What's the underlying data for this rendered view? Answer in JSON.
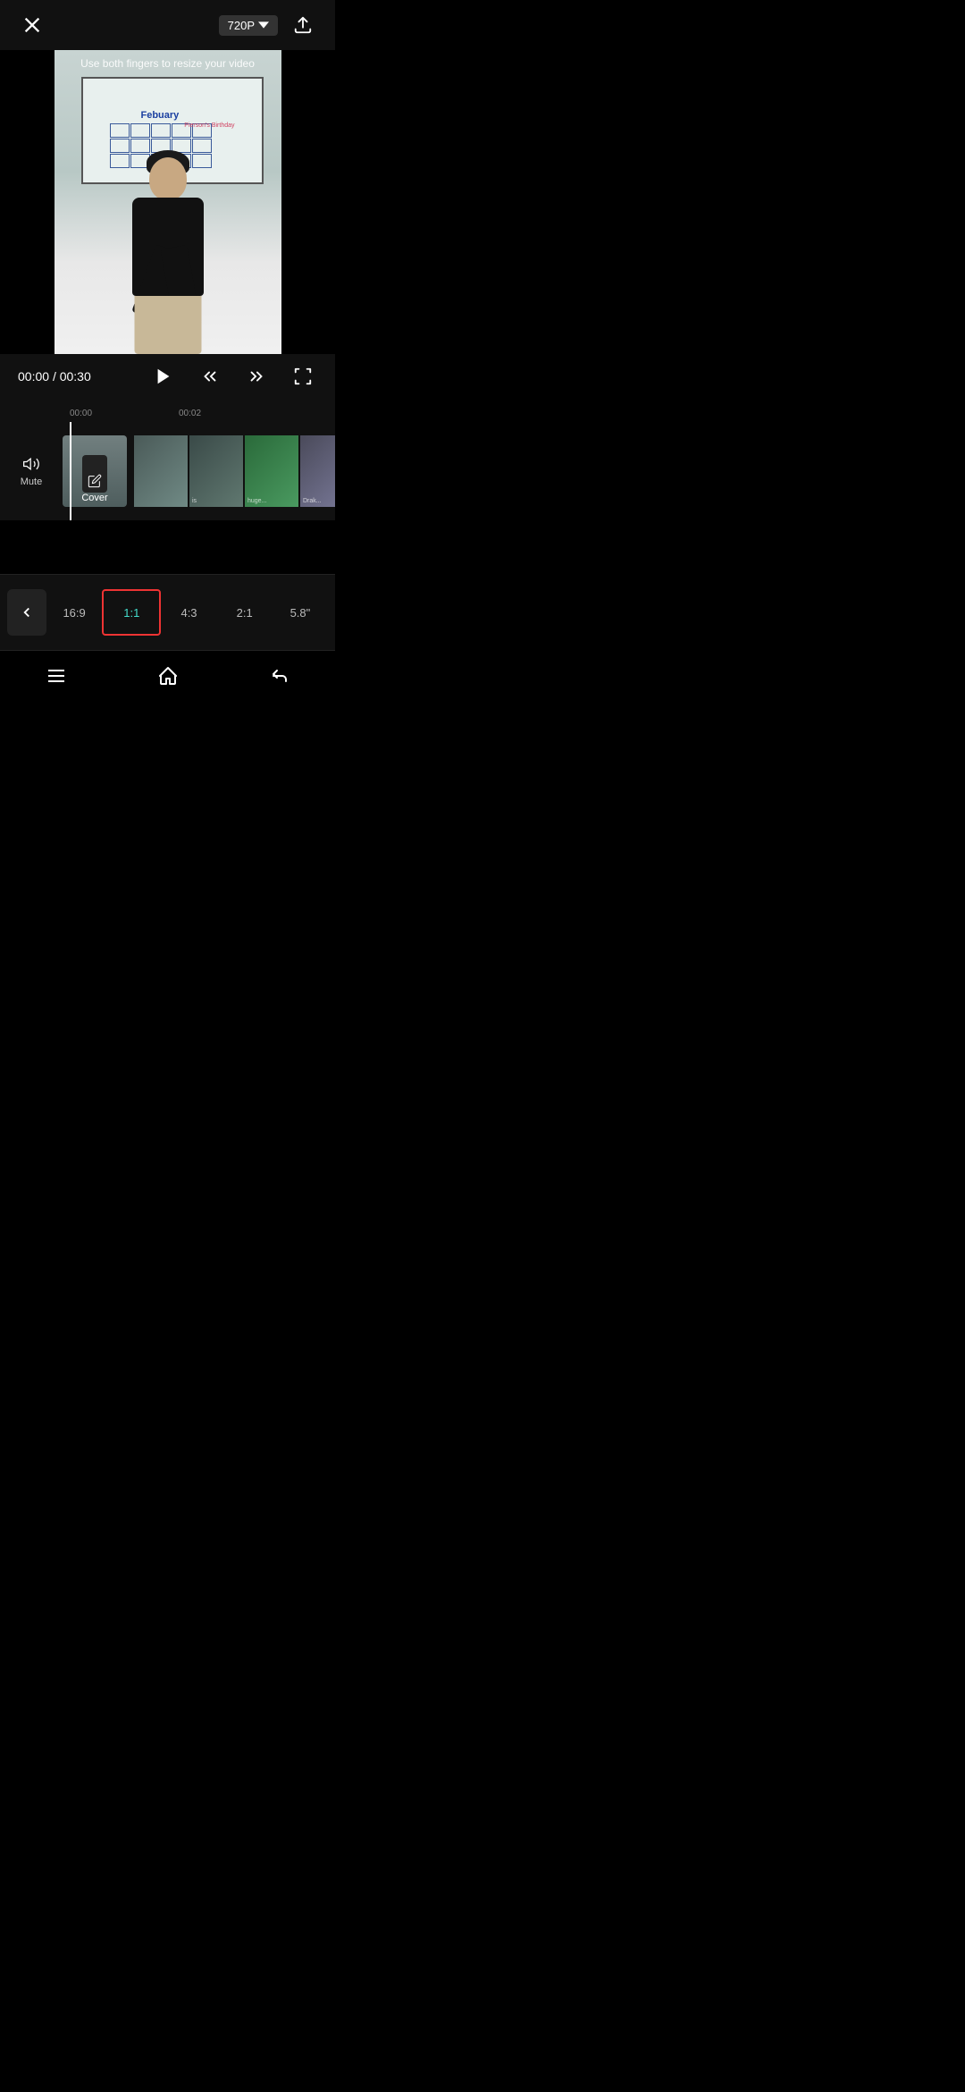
{
  "header": {
    "close_label": "×",
    "quality_label": "720P",
    "quality_dropdown": "▾"
  },
  "video": {
    "hint_text": "Use both fingers to resize your video",
    "whiteboard_month": "Febuary",
    "whiteboard_event": "Pierson's Birthday"
  },
  "playback": {
    "current_time": "00:00",
    "separator": "/",
    "total_time": "00:30"
  },
  "timeline": {
    "ruler_start": "00:00",
    "ruler_mid": "00:02",
    "mute_label": "Mute",
    "cover_label": "Cover",
    "frames": [
      {
        "label": ""
      },
      {
        "label": "is"
      },
      {
        "label": "huge..."
      },
      {
        "label": "Drak..."
      }
    ]
  },
  "aspect_ratios": {
    "items": [
      {
        "label": "16:9",
        "active": false
      },
      {
        "label": "1:1",
        "active": true
      },
      {
        "label": "4:3",
        "active": false
      },
      {
        "label": "2:1",
        "active": false
      },
      {
        "label": "5.8\"",
        "active": false
      }
    ]
  },
  "bottom_nav": {
    "menu_icon": "menu",
    "home_icon": "home",
    "back_icon": "back"
  }
}
